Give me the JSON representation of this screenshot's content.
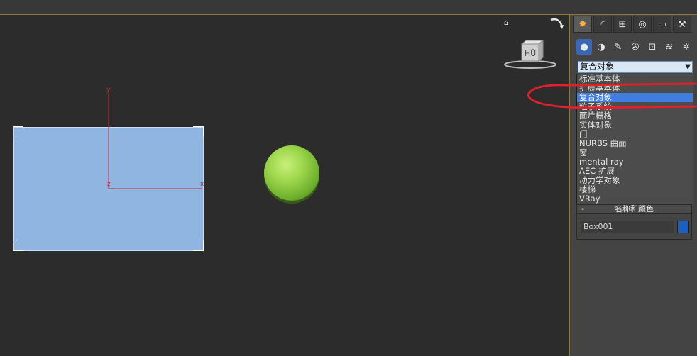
{
  "viewport": {
    "viewcube_label": "HŨ",
    "gizmo_y_label": "y",
    "gizmo_x_label": "x",
    "gizmo_origin_label": "z"
  },
  "command_panel": {
    "tabs": [
      {
        "icon": "create-icon",
        "glyph": "✹",
        "active": true
      },
      {
        "icon": "modify-icon",
        "glyph": "◜",
        "active": false
      },
      {
        "icon": "hierarchy-icon",
        "glyph": "⊞",
        "active": false
      },
      {
        "icon": "motion-icon",
        "glyph": "◎",
        "active": false
      },
      {
        "icon": "display-icon",
        "glyph": "▭",
        "active": false
      },
      {
        "icon": "utilities-icon",
        "glyph": "⚒",
        "active": false
      }
    ],
    "sub_icons": [
      {
        "icon": "geometry-icon",
        "glyph": "●",
        "active": true
      },
      {
        "icon": "shapes-icon",
        "glyph": "◑",
        "active": false
      },
      {
        "icon": "lights-icon",
        "glyph": "✎",
        "active": false
      },
      {
        "icon": "cameras-icon",
        "glyph": "✇",
        "active": false
      },
      {
        "icon": "helpers-icon",
        "glyph": "⊡",
        "active": false
      },
      {
        "icon": "spacewarps-icon",
        "glyph": "≋",
        "active": false
      },
      {
        "icon": "systems-icon",
        "glyph": "✲",
        "active": false
      }
    ],
    "dropdown_value": "复合对象",
    "dropdown_options": [
      "标准基本体",
      "扩展基本体",
      "复合对象",
      "粒子系统",
      "面片栅格",
      "实体对象",
      "门",
      "NURBS 曲面",
      "窗",
      "mental ray",
      "AEC 扩展",
      "动力学对象",
      "楼梯",
      "VRay"
    ],
    "selected_index": 2,
    "rollout": {
      "toggle": "-",
      "title": "名称和颜色",
      "object_name": "Box001",
      "object_color": "#1c5fc2"
    }
  },
  "colors": {
    "box_fill": "#8fb5e0",
    "sphere_green": "#9dd64c",
    "gizmo_red": "#c0303a",
    "highlight_red": "#e0202a",
    "selection_blue": "#3f7ee0"
  }
}
